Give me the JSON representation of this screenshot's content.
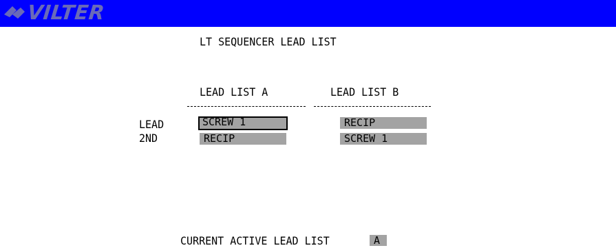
{
  "header": {
    "logo_text": "VILTER",
    "bar_color": "#0000ff",
    "logo_color": "#6a6ab8",
    "logo_icon": "vilter-logo-icon"
  },
  "page": {
    "title": "LT SEQUENCER LEAD LIST"
  },
  "lead_lists": {
    "list_a_header": "LEAD LIST A",
    "list_b_header": "LEAD LIST B",
    "divider_a": "-----------------",
    "divider_b": "-----------------",
    "rows": [
      {
        "label": "LEAD",
        "list_a": "SCREW 1",
        "list_b": "RECIP"
      },
      {
        "label": "2ND",
        "list_a": "RECIP",
        "list_b": "SCREW 1"
      }
    ],
    "selected_field": "rows.0.list_a"
  },
  "active": {
    "label": "CURRENT ACTIVE LEAD LIST",
    "value": "A"
  },
  "colors": {
    "field_background": "#a3a3a3",
    "text": "#000000",
    "background": "#ffffff"
  }
}
